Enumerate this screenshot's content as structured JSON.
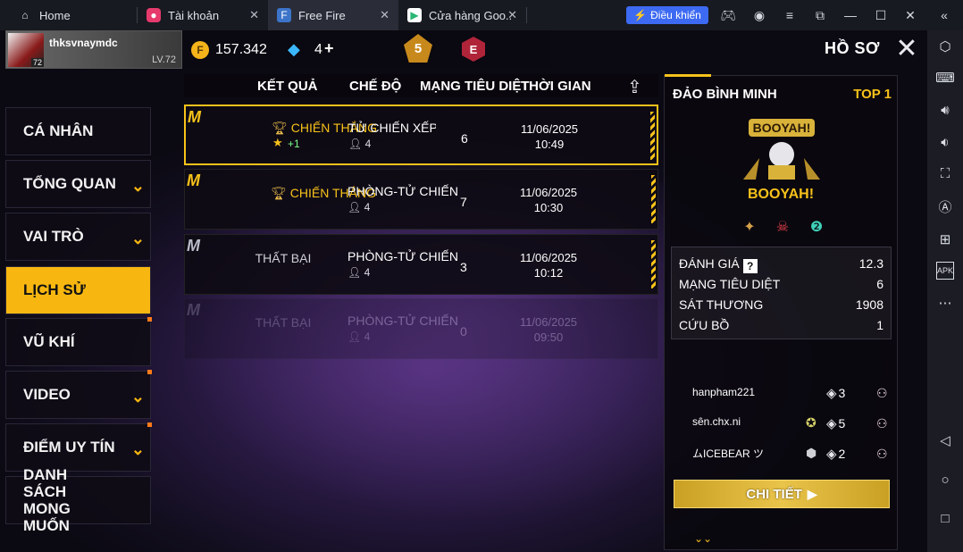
{
  "window": {
    "tabs": [
      {
        "label": "Home",
        "icon": "home-icon"
      },
      {
        "label": "Tài khoản",
        "icon": "account-icon"
      },
      {
        "label": "Free Fire",
        "icon": "freefire-icon"
      },
      {
        "label": "Cửa hàng Goo...",
        "icon": "play-store-icon"
      }
    ],
    "control_label": "Điều khiển"
  },
  "player": {
    "name": "thksvnaymdc",
    "level": "LV.72",
    "avatar_level": "72"
  },
  "currency": {
    "coins": "157.342",
    "coin_symbol": "F",
    "diamonds": "4",
    "diamond_plus": "+"
  },
  "badges": {
    "rank": "5",
    "e": "E"
  },
  "header": {
    "title": "HỒ SƠ"
  },
  "sidebar": {
    "items": [
      {
        "label": "CÁ NHÂN",
        "chev": "",
        "dot": false
      },
      {
        "label": "TỔNG QUAN",
        "chev": "⌄",
        "dot": false
      },
      {
        "label": "VAI TRÒ",
        "chev": "⌄",
        "dot": false
      },
      {
        "label": "LỊCH SỬ",
        "chev": "",
        "dot": false
      },
      {
        "label": "VŨ KHÍ",
        "chev": "",
        "dot": true
      },
      {
        "label": "VIDEO",
        "chev": "⌄",
        "dot": true
      },
      {
        "label": "ĐIỂM UY TÍN",
        "chev": "⌄",
        "dot": true
      },
      {
        "label": "DANH SÁCH MONG MUỐN",
        "chev": "",
        "dot": false
      }
    ]
  },
  "table": {
    "headers": [
      "KẾT QUẢ",
      "CHẾ ĐỘ",
      "MẠNG TIÊU DIỆT",
      "THỜI GIAN"
    ],
    "rows": [
      {
        "result": "CHIẾN THẮNG",
        "star_bonus": "+1",
        "mode": "TỬ CHIẾN XẾP HẠNG",
        "players": "4",
        "kills": "6",
        "date": "11/06/2025",
        "time": "10:49"
      },
      {
        "result": "CHIẾN THẮNG",
        "star_bonus": "",
        "mode": "PHÒNG-TỬ CHIẾN",
        "players": "4",
        "kills": "7",
        "date": "11/06/2025",
        "time": "10:30"
      },
      {
        "result": "THẤT BẠI",
        "star_bonus": "",
        "mode": "PHÒNG-TỬ CHIẾN",
        "players": "4",
        "kills": "3",
        "date": "11/06/2025",
        "time": "10:12"
      },
      {
        "result": "THẤT BẠI",
        "star_bonus": "",
        "mode": "PHÒNG-TỬ CHIẾN",
        "players": "4",
        "kills": "0",
        "date": "11/06/2025",
        "time": "09:50"
      }
    ]
  },
  "match_detail": {
    "map": "ĐẢO BÌNH MINH",
    "rank": "TOP 1",
    "banner_text": "BOOYAH!",
    "result": "BOOYAH!",
    "stats": [
      {
        "label": "ĐÁNH GIÁ",
        "value": "12.3"
      },
      {
        "label": "MẠNG TIÊU DIỆT",
        "value": "6"
      },
      {
        "label": "SÁT THƯƠNG",
        "value": "1908"
      },
      {
        "label": "CỨU BỒ",
        "value": "1"
      }
    ],
    "teammates": [
      {
        "name": "hanpham221",
        "kills": "3"
      },
      {
        "name": "sên.chx.ni",
        "kills": "5"
      },
      {
        "name": "ムICEBEAR ツ",
        "kills": "2"
      }
    ],
    "detail_button": "CHI TIẾT"
  },
  "colors": {
    "accent": "#f8c21a",
    "tab_active": "#2a2d37",
    "control_btn": "#3d6af2"
  }
}
